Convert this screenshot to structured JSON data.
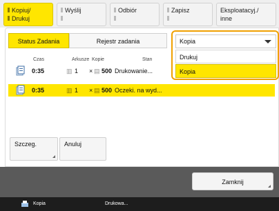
{
  "tabs": [
    {
      "line1": "Kopiuj/",
      "line2": "Drukuj"
    },
    {
      "line1": "Wyślij",
      "line2": ""
    },
    {
      "line1": "Odbiór",
      "line2": ""
    },
    {
      "line1": "Zapisz",
      "line2": ""
    },
    {
      "line1": "Eksploatacyj./",
      "line2": "inne"
    }
  ],
  "segment": {
    "status_label": "Status Zadania",
    "log_label": "Rejestr zadania"
  },
  "dropdown": {
    "selected": "Kopia",
    "options": [
      "Drukuj",
      "Kopia"
    ],
    "highlighted": "Kopia"
  },
  "columns": {
    "time": "Czas",
    "sheets": "Arkusze",
    "copies": "Kopie",
    "status": "Stan"
  },
  "jobs": [
    {
      "time": "0:35",
      "sheets": "1",
      "copies": "500",
      "status": "Drukowanie..."
    },
    {
      "time": "0:35",
      "sheets": "1",
      "copies": "500",
      "status": "Oczeki. na wyd..."
    }
  ],
  "buttons": {
    "details": "Szczeg.",
    "cancel": "Anuluj",
    "close": "Zamknij"
  },
  "statusbar": {
    "job_type": "Kopia",
    "state": "Drukowa..."
  },
  "colors": {
    "accent": "#ffe600",
    "focus_outline": "#f0a000",
    "bottom_bar": "#5a5a5a",
    "status_bar": "#1d1d1d"
  }
}
